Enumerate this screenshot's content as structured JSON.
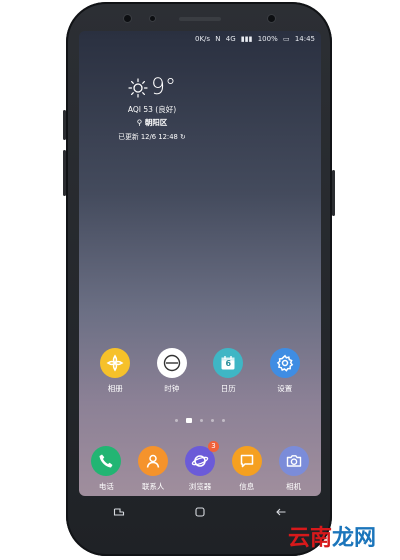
{
  "statusbar": {
    "net_speed": "0K/s",
    "extra": "N",
    "signal": "4G",
    "battery": "100%",
    "time": "14:45"
  },
  "weather": {
    "temperature": "9°",
    "aqi": "AQI 53 (良好)",
    "location": "朝阳区",
    "updated": "已更新 12/6 12:48"
  },
  "apps": [
    {
      "label": "相册",
      "icon": "gallery-icon",
      "color": "#f6c12a"
    },
    {
      "label": "时钟",
      "icon": "clock-icon",
      "color": "#ffffff"
    },
    {
      "label": "日历",
      "icon": "calendar-icon",
      "color": "#3fb6c5",
      "day": "6"
    },
    {
      "label": "设置",
      "icon": "settings-icon",
      "color": "#3f8de3"
    }
  ],
  "dock": [
    {
      "label": "电话",
      "icon": "phone-icon",
      "color": "#22b573"
    },
    {
      "label": "联系人",
      "icon": "contacts-icon",
      "color": "#f5932c"
    },
    {
      "label": "浏览器",
      "icon": "browser-icon",
      "color": "#6b5bd8",
      "badge": "3"
    },
    {
      "label": "信息",
      "icon": "messages-icon",
      "color": "#f5a020"
    },
    {
      "label": "相机",
      "icon": "camera-icon",
      "color": "#7b8cd9"
    }
  ],
  "watermark": {
    "part1": "云南",
    "part2": "龙网"
  }
}
